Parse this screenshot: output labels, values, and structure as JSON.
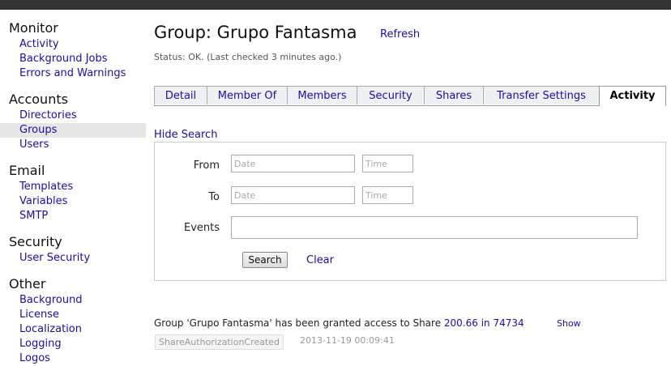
{
  "sidebar": {
    "sections": [
      {
        "heading": "Monitor",
        "items": [
          "Activity",
          "Background Jobs",
          "Errors and Warnings"
        ]
      },
      {
        "heading": "Accounts",
        "items": [
          "Directories",
          "Groups",
          "Users"
        ]
      },
      {
        "heading": "Email",
        "items": [
          "Templates",
          "Variables",
          "SMTP"
        ]
      },
      {
        "heading": "Security",
        "items": [
          "User Security"
        ]
      },
      {
        "heading": "Other",
        "items": [
          "Background",
          "License",
          "Localization",
          "Logging",
          "Logos"
        ]
      }
    ],
    "active": "Groups"
  },
  "header": {
    "title": "Group: Grupo Fantasma",
    "refresh": "Refresh",
    "status": "Status: OK. (Last checked 3 minutes ago.)"
  },
  "tabs": [
    "Detail",
    "Member Of",
    "Members",
    "Security",
    "Shares",
    "Transfer Settings",
    "Activity"
  ],
  "active_tab": "Activity",
  "search": {
    "hide_label": "Hide Search",
    "from_label": "From",
    "to_label": "To",
    "events_label": "Events",
    "date_placeholder": "Date",
    "time_placeholder": "Time",
    "search_button": "Search",
    "clear_label": "Clear"
  },
  "activity": {
    "text": "Group 'Grupo Fantasma' has been granted access to Share ",
    "link": "200.66 in 74734",
    "show": "Show",
    "badge": "ShareAuthorizationCreated",
    "timestamp": "2013-11-19 00:09:41"
  }
}
